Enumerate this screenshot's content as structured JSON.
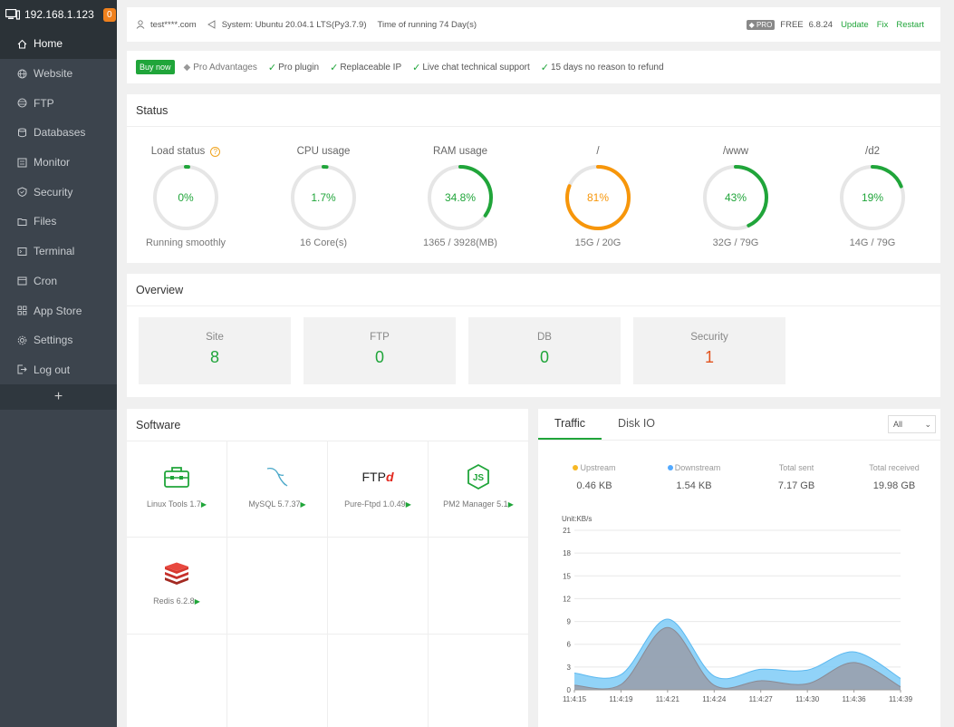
{
  "sidebar": {
    "ip": "192.168.1.123",
    "badge": "0",
    "items": [
      {
        "label": "Home",
        "icon": "home-icon",
        "active": true
      },
      {
        "label": "Website",
        "icon": "globe-icon"
      },
      {
        "label": "FTP",
        "icon": "ftp-icon"
      },
      {
        "label": "Databases",
        "icon": "database-icon"
      },
      {
        "label": "Monitor",
        "icon": "monitor-icon"
      },
      {
        "label": "Security",
        "icon": "shield-icon"
      },
      {
        "label": "Files",
        "icon": "folder-icon"
      },
      {
        "label": "Terminal",
        "icon": "terminal-icon"
      },
      {
        "label": "Cron",
        "icon": "calendar-icon"
      },
      {
        "label": "App Store",
        "icon": "grid-icon"
      },
      {
        "label": "Settings",
        "icon": "gear-icon"
      },
      {
        "label": "Log out",
        "icon": "logout-icon"
      }
    ],
    "add": "+"
  },
  "topbar": {
    "user": "test****.com",
    "system": "System:  Ubuntu 20.04.1 LTS(Py3.7.9)",
    "uptime": "Time of running 74 Day(s)",
    "pro": "PRO",
    "free": "FREE",
    "version": "6.8.24",
    "update": "Update",
    "fix": "Fix",
    "restart": "Restart"
  },
  "probar": {
    "buy": "Buy now",
    "advantages": "Pro Advantages",
    "features": [
      "Pro plugin",
      "Replaceable IP",
      "Live chat technical support",
      "15 days no reason to refund"
    ]
  },
  "status": {
    "title": "Status",
    "gauges": [
      {
        "label": "Load status",
        "value": "0%",
        "pct": 0,
        "sub": "Running smoothly",
        "color": "#20a53a"
      },
      {
        "label": "CPU usage",
        "value": "1.7%",
        "pct": 1.7,
        "sub": "16 Core(s)",
        "color": "#20a53a"
      },
      {
        "label": "RAM usage",
        "value": "34.8%",
        "pct": 34.8,
        "sub": "1365 / 3928(MB)",
        "color": "#20a53a"
      },
      {
        "label": "/",
        "value": "81%",
        "pct": 81,
        "sub": "15G / 20G",
        "color": "#f7960a"
      },
      {
        "label": "/www",
        "value": "43%",
        "pct": 43,
        "sub": "32G / 79G",
        "color": "#20a53a"
      },
      {
        "label": "/d2",
        "value": "19%",
        "pct": 19,
        "sub": "14G / 79G",
        "color": "#20a53a"
      }
    ]
  },
  "overview": {
    "title": "Overview",
    "cards": [
      {
        "label": "Site",
        "value": "8",
        "color": "#20a53a"
      },
      {
        "label": "FTP",
        "value": "0",
        "color": "#20a53a"
      },
      {
        "label": "DB",
        "value": "0",
        "color": "#20a53a"
      },
      {
        "label": "Security",
        "value": "1",
        "color": "#e2531e"
      }
    ]
  },
  "software": {
    "title": "Software",
    "items": [
      {
        "name": "Linux Tools 1.7",
        "icon": "toolbox-icon"
      },
      {
        "name": "MySQL 5.7.37",
        "icon": "mysql-icon"
      },
      {
        "name": "Pure-Ftpd 1.0.49",
        "icon": "ftp-logo-icon",
        "logo": "FTP"
      },
      {
        "name": "PM2 Manager 5.1",
        "icon": "nodejs-icon"
      },
      {
        "name": "Redis 6.2.8",
        "icon": "redis-icon"
      }
    ]
  },
  "traffic": {
    "tabs": [
      "Traffic",
      "Disk IO"
    ],
    "select": "All",
    "stats": [
      {
        "label": "Upstream",
        "value": "0.46 KB",
        "dot": "#f7b824"
      },
      {
        "label": "Downstream",
        "value": "1.54 KB",
        "dot": "#52a9ff"
      },
      {
        "label": "Total sent",
        "value": "7.17 GB"
      },
      {
        "label": "Total received",
        "value": "19.98 GB"
      }
    ]
  },
  "chart_data": {
    "type": "area",
    "unit": "Unit:KB/s",
    "yticks": [
      "21",
      "18",
      "15",
      "12",
      "9",
      "6",
      "3",
      "0"
    ],
    "ylim": [
      0,
      21
    ],
    "x": [
      "11:4:15",
      "11:4:19",
      "11:4:21",
      "11:4:24",
      "11:4:27",
      "11:4:30",
      "11:4:36",
      "11:4:39"
    ],
    "series": [
      {
        "name": "Downstream",
        "color": "#7ecbf7",
        "values": [
          2.2,
          2.0,
          9.3,
          1.8,
          2.7,
          2.6,
          5.0,
          1.5
        ]
      },
      {
        "name": "Upstream",
        "color": "#9a9aa4",
        "values": [
          0.6,
          0.7,
          8.2,
          0.6,
          1.2,
          0.8,
          3.6,
          0.4
        ]
      }
    ]
  }
}
